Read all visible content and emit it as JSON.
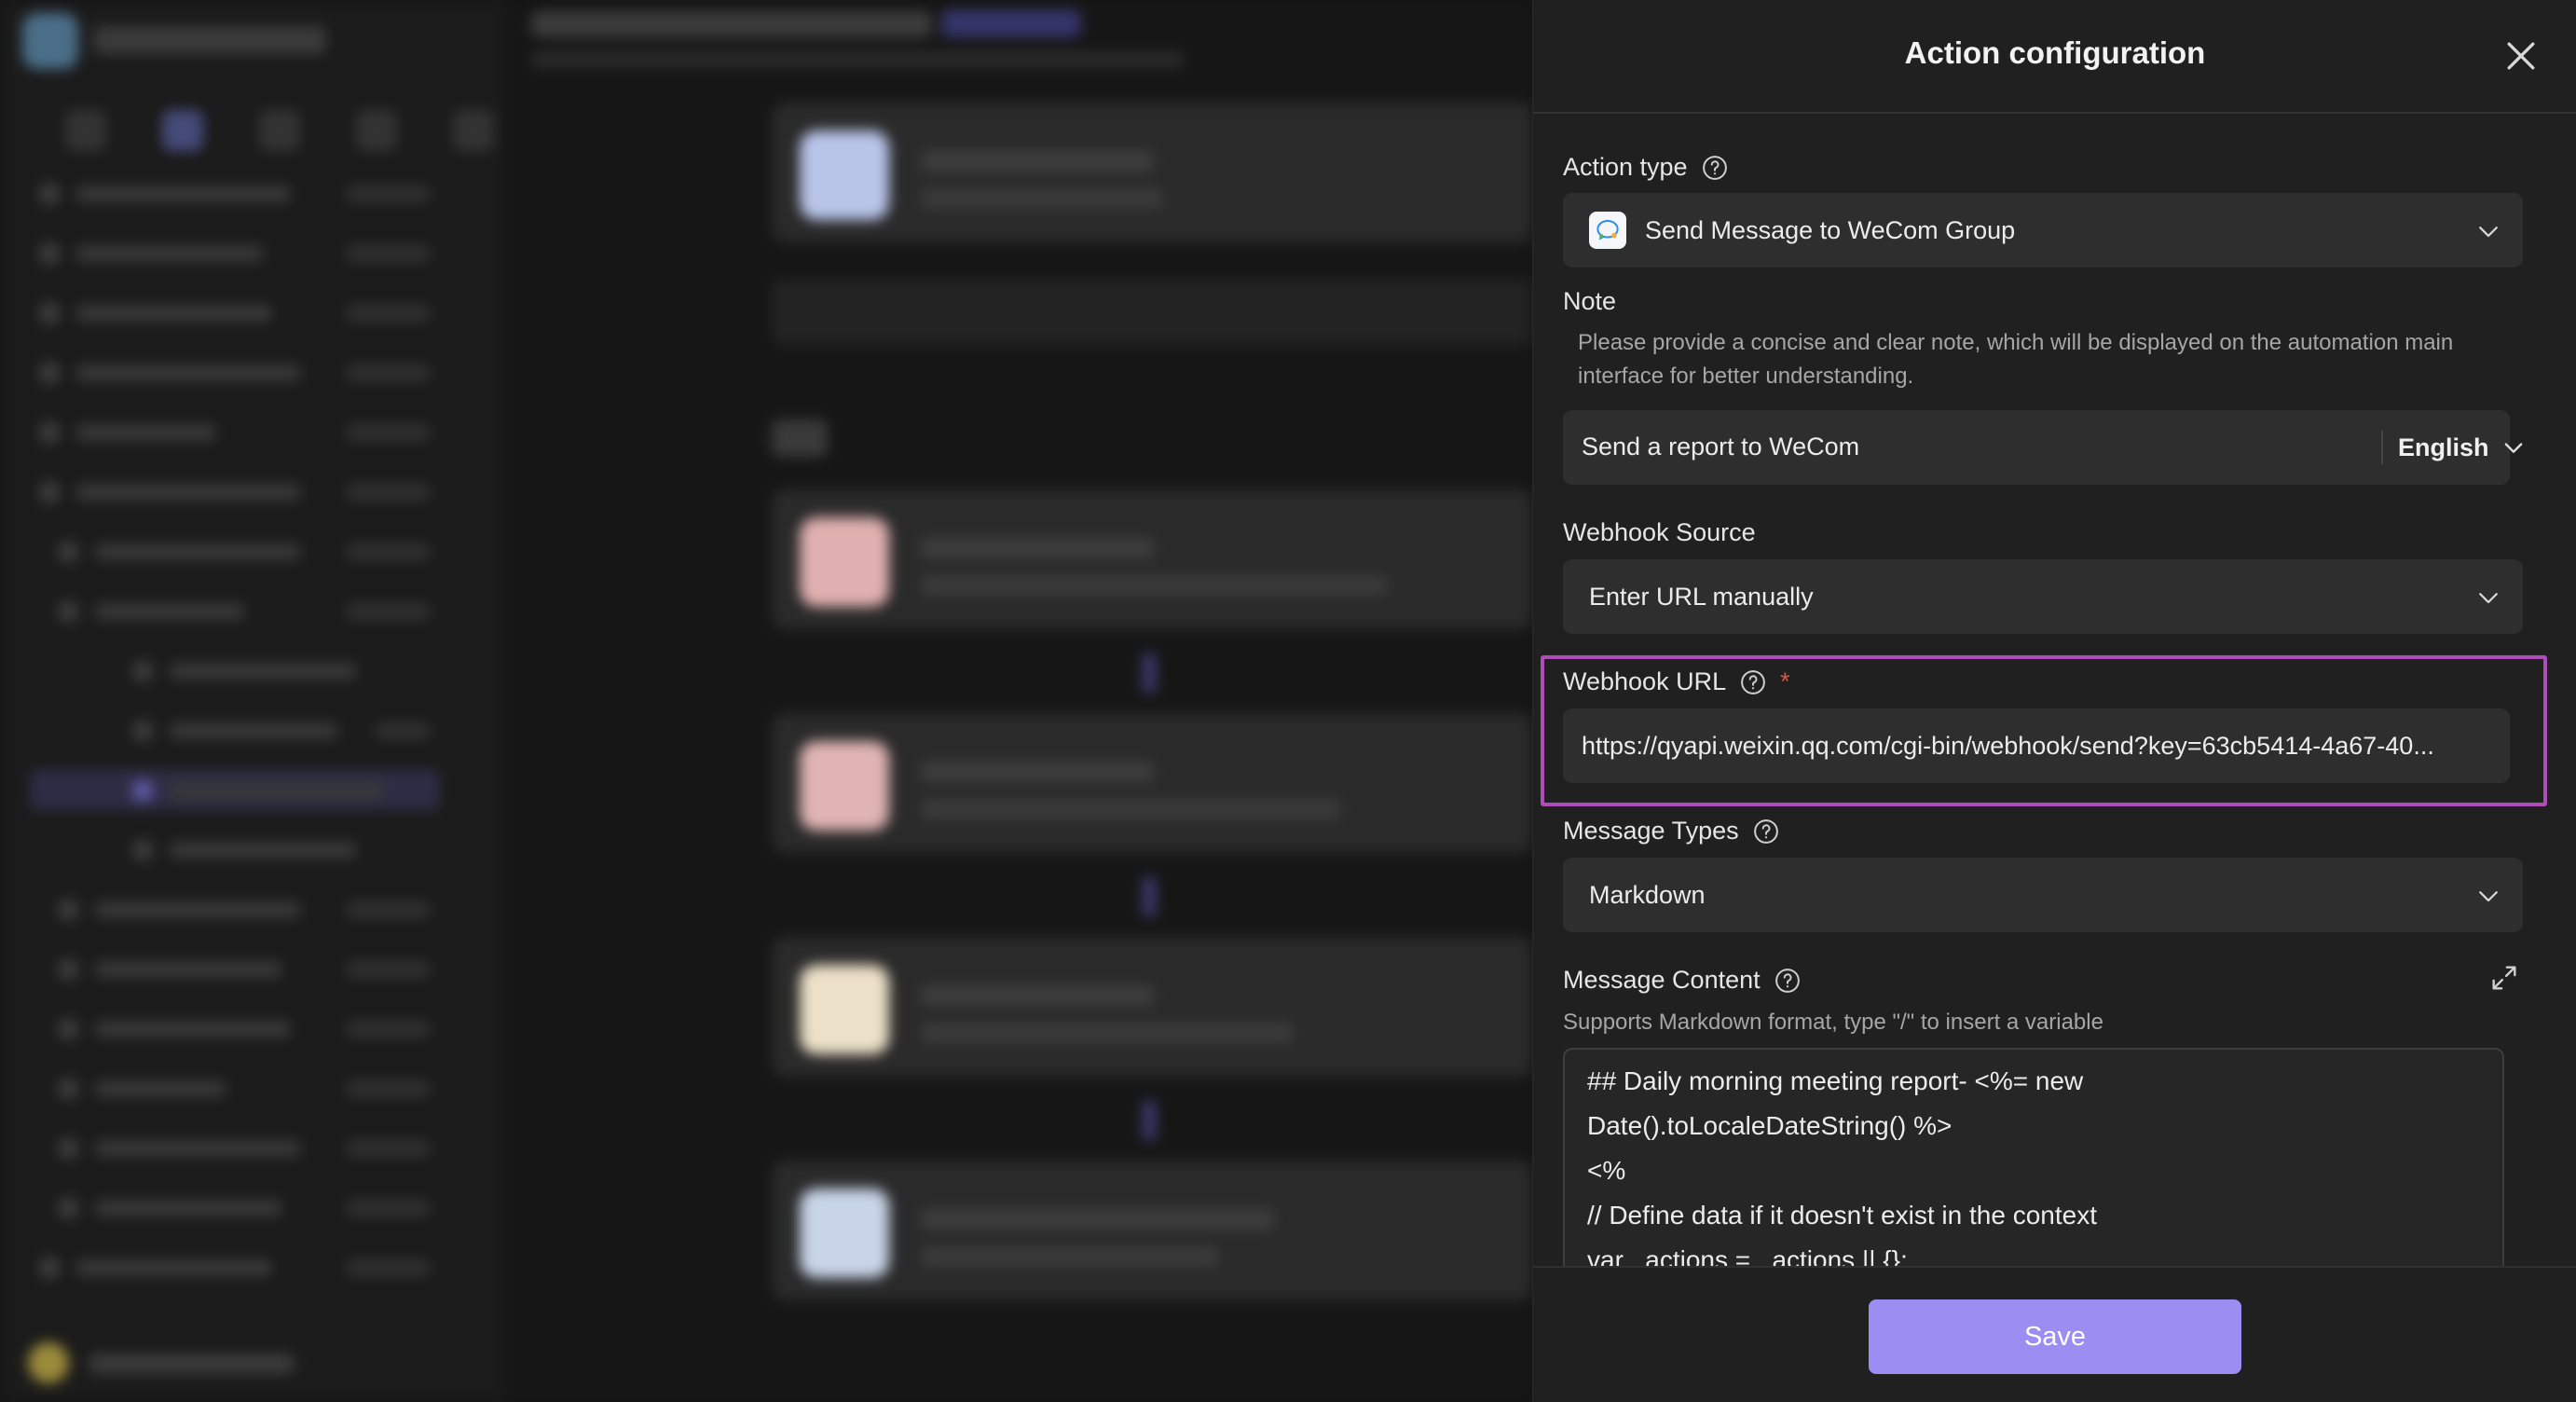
{
  "drawer": {
    "title": "Action configuration",
    "action_type": {
      "label": "Action type",
      "value": "Send Message to WeCom Group"
    },
    "note": {
      "label": "Note",
      "hint": "Please provide a concise and clear note, which will be displayed on the automation main interface for better understanding.",
      "value": "Send a report to WeCom",
      "language": "English"
    },
    "webhook_source": {
      "label": "Webhook Source",
      "value": "Enter URL manually"
    },
    "webhook_url": {
      "label": "Webhook URL",
      "required_mark": "*",
      "value": "https://qyapi.weixin.qq.com/cgi-bin/webhook/send?key=63cb5414-4a67-40..."
    },
    "message_types": {
      "label": "Message Types",
      "value": "Markdown"
    },
    "message_content": {
      "label": "Message Content",
      "hint": "Supports Markdown format, type \"/\" to insert a variable",
      "lines": [
        "## Daily morning meeting report- <%= new",
        "Date().toLocaleDateString() %>",
        "<%",
        "// Define data if it doesn't exist in the context",
        "var _actions = _actions || {};"
      ]
    },
    "save_label": "Save"
  },
  "colors": {
    "accent": "#9b8ef2",
    "highlight": "#b04cb8",
    "required": "#e0533c",
    "panel": "#202020",
    "field": "#2e2e2e"
  },
  "icons": [
    "close-icon",
    "help-icon",
    "chevron-down-icon",
    "wecom-icon",
    "expand-icon"
  ]
}
